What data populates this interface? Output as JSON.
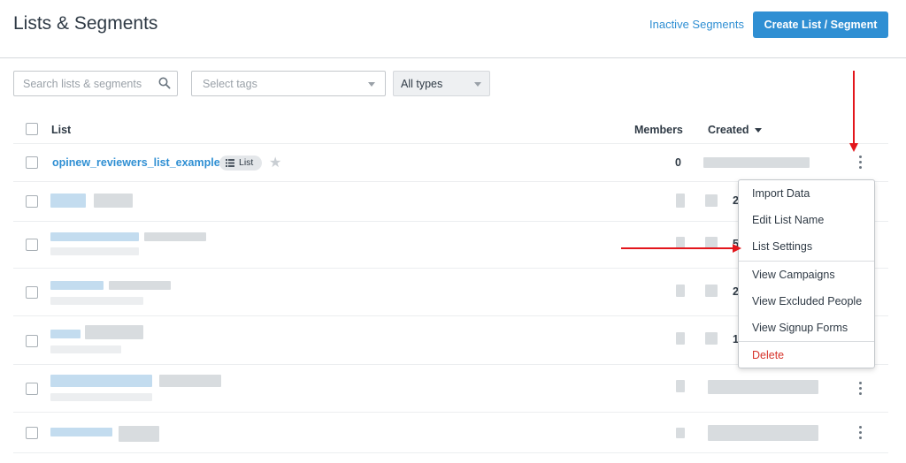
{
  "header": {
    "title": "Lists & Segments",
    "inactive_link": "Inactive Segments",
    "create_button": "Create List / Segment"
  },
  "filters": {
    "search_placeholder": "Search lists & segments",
    "tags_placeholder": "Select tags",
    "type_value": "All types"
  },
  "table": {
    "columns": {
      "list": "List",
      "members": "Members",
      "created": "Created"
    },
    "first_row": {
      "name": "opinew_reviewers_list_example",
      "badge": "List",
      "members": "0"
    },
    "partial_digits": [
      "2",
      "5",
      "2",
      "1"
    ]
  },
  "context_menu": {
    "items": [
      "Import Data",
      "Edit List Name",
      "List Settings",
      "View Campaigns",
      "View Excluded People",
      "View Signup Forms",
      "Delete"
    ]
  },
  "colors": {
    "accent": "#2f8fd3",
    "danger": "#d6332a",
    "annotation_arrow": "#e3161c"
  },
  "icons": {
    "search": "search-icon",
    "caret": "chevron-down-icon",
    "badge": "list-icon",
    "star": "star-icon",
    "more": "kebab-menu-icon"
  }
}
